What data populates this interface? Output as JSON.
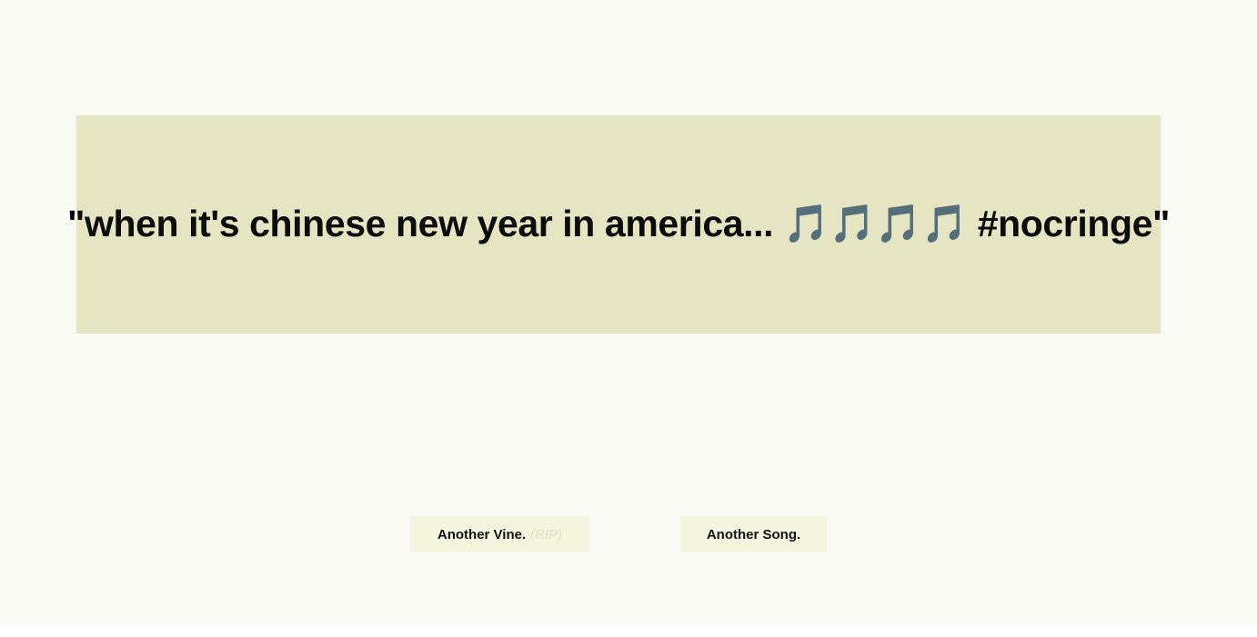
{
  "quote": {
    "text": "\"when it's chinese new year in america... 🎵🎵🎵🎵 #nocringe\""
  },
  "buttons": {
    "vine_label": "Another Vine.",
    "vine_note": "(RIP)",
    "song_label": "Another Song."
  },
  "colors": {
    "page_background": "#fafaf4",
    "card_background": "#e5e4c3",
    "button_background": "#f3f5df",
    "rip_text": "#e2e2c2"
  }
}
